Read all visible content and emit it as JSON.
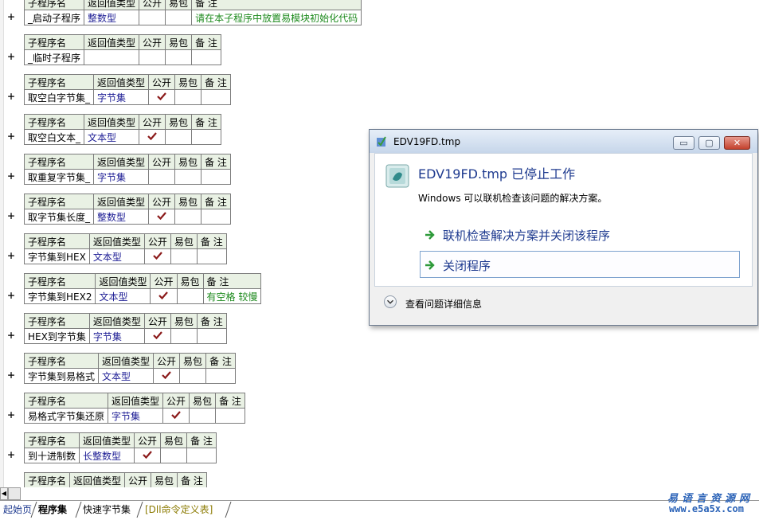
{
  "header_labels": {
    "name": "子程序名",
    "return_type": "返回值类型",
    "public": "公开",
    "easy_pack": "易包",
    "remark": "备 注"
  },
  "expander_symbol": "+",
  "check_mark_icon": "check-icon",
  "subroutines": [
    {
      "name": "_启动子程序",
      "return_type": "整数型",
      "public": false,
      "remark": "请在本子程序中放置易模块初始化代码"
    },
    {
      "name": "_临时子程序",
      "return_type": "",
      "public": false,
      "remark": ""
    },
    {
      "name": "取空白字节集_",
      "return_type": "字节集",
      "public": true,
      "remark": ""
    },
    {
      "name": "取空白文本_",
      "return_type": "文本型",
      "public": true,
      "remark": ""
    },
    {
      "name": "取重复字节集_",
      "return_type": "字节集",
      "public": false,
      "remark": ""
    },
    {
      "name": "取字节集长度_",
      "return_type": "整数型",
      "public": true,
      "remark": ""
    },
    {
      "name": "字节集到HEX",
      "return_type": "文本型",
      "public": true,
      "remark": ""
    },
    {
      "name": "字节集到HEX2",
      "return_type": "文本型",
      "public": true,
      "remark": "有空格 较慢"
    },
    {
      "name": "HEX到字节集",
      "return_type": "字节集",
      "public": true,
      "remark": ""
    },
    {
      "name": "字节集到易格式",
      "return_type": "文本型",
      "public": true,
      "remark": ""
    },
    {
      "name": "易格式字节集还原",
      "return_type": "字节集",
      "public": true,
      "remark": ""
    },
    {
      "name": "到十进制数",
      "return_type": "长整数型",
      "public": true,
      "remark": ""
    }
  ],
  "dialog": {
    "title": "EDV19FD.tmp",
    "heading": "EDV19FD.tmp 已停止工作",
    "description": "Windows 可以联机检查该问题的解决方案。",
    "option_check_online": "联机检查解决方案并关闭该程序",
    "option_close": "关闭程序",
    "details": "查看问题详细信息",
    "min_symbol": "▭",
    "max_symbol": "▢",
    "close_symbol": "✕"
  },
  "tabs": {
    "start_page": "起始页",
    "program_set": "程序集",
    "fast_bytes": "快速字节集",
    "dll_commands": "[Dll命令定义表]"
  },
  "watermark": {
    "site_name": "易语言资源网",
    "url": "www.e5a5x.com"
  },
  "colors": {
    "header_bg": "#e9f1e4",
    "return_type": "#1c1c94",
    "remark": "#1d8a1d",
    "check": "#8b1a1a",
    "dialog_heading": "#1e3a8f"
  }
}
